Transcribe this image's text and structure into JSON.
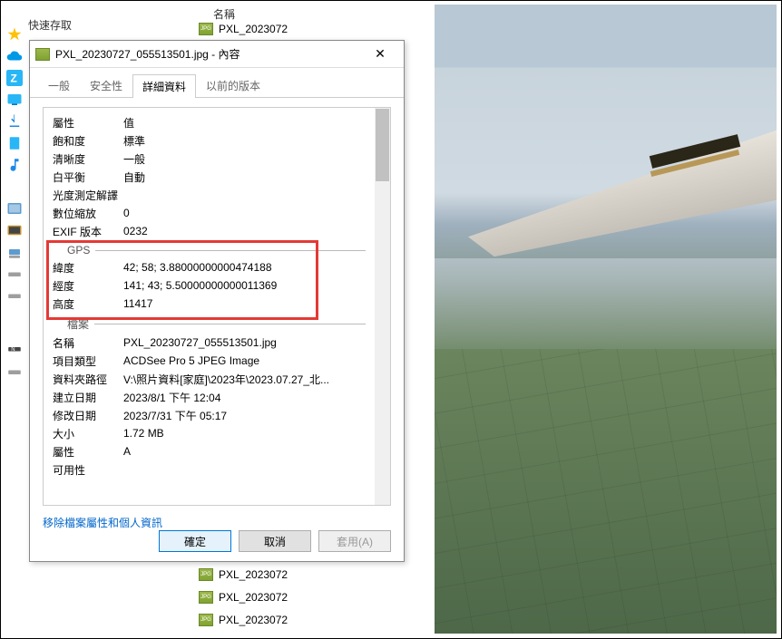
{
  "sidebar": {
    "quick_access": "快速存取"
  },
  "explorer": {
    "col_name": "名稱",
    "files": [
      "PXL_2023072",
      "PXL_2023072",
      "PXL_2023072",
      "PXL_2023072",
      "PXL_2023072"
    ]
  },
  "dialog": {
    "title": "PXL_20230727_055513501.jpg - 內容",
    "tabs": {
      "general": "一般",
      "security": "安全性",
      "details": "詳細資料",
      "previous": "以前的版本"
    },
    "header_row": {
      "prop": "屬性",
      "val": "值"
    },
    "rows_top": [
      {
        "label": "飽和度",
        "value": "標準"
      },
      {
        "label": "清晰度",
        "value": "一般"
      },
      {
        "label": "白平衡",
        "value": "自動"
      },
      {
        "label": "光度測定解譯",
        "value": ""
      },
      {
        "label": "數位縮放",
        "value": "0"
      },
      {
        "label": "EXIF 版本",
        "value": "0232"
      }
    ],
    "section_gps": "GPS",
    "gps_rows": [
      {
        "label": "緯度",
        "value": "42; 58; 3.88000000000474188"
      },
      {
        "label": "經度",
        "value": "141; 43; 5.50000000000011369"
      },
      {
        "label": "高度",
        "value": "11417"
      }
    ],
    "section_file": "檔案",
    "file_rows": [
      {
        "label": "名稱",
        "value": "PXL_20230727_055513501.jpg"
      },
      {
        "label": "項目類型",
        "value": "ACDSee Pro 5 JPEG Image"
      },
      {
        "label": "資料夾路徑",
        "value": "V:\\照片資料[家庭]\\2023年\\2023.07.27_北..."
      },
      {
        "label": "建立日期",
        "value": "2023/8/1 下午 12:04"
      },
      {
        "label": "修改日期",
        "value": "2023/7/31 下午 05:17"
      },
      {
        "label": "大小",
        "value": "1.72 MB"
      },
      {
        "label": "屬性",
        "value": "A"
      },
      {
        "label": "可用性",
        "value": ""
      }
    ],
    "link": "移除檔案屬性和個人資訊",
    "buttons": {
      "ok": "確定",
      "cancel": "取消",
      "apply": "套用(A)"
    }
  }
}
